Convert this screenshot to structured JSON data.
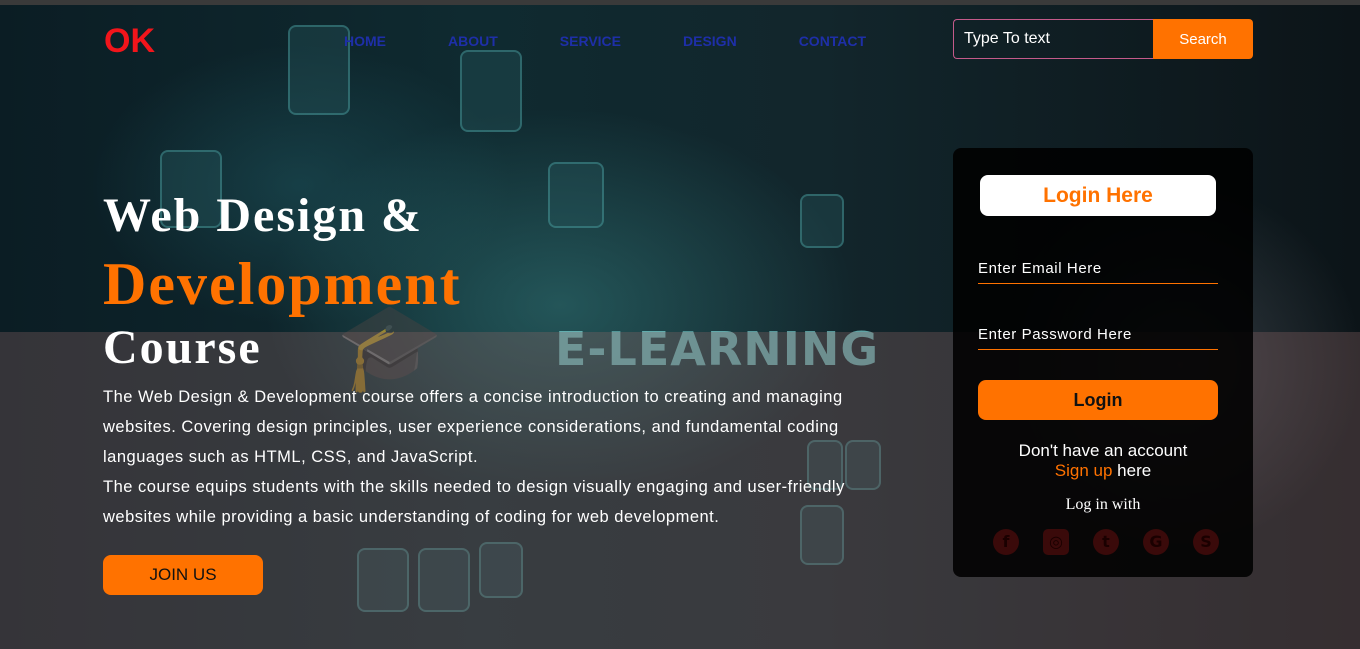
{
  "brand": {
    "logo": "OK",
    "logo_color": "#f2151b"
  },
  "nav": {
    "items": [
      "HOME",
      "ABOUT",
      "SERVICE",
      "DESIGN",
      "CONTACT"
    ],
    "color": "#1e2fa8"
  },
  "search": {
    "placeholder": "Type To text",
    "button_label": "Search"
  },
  "hero": {
    "title_line1": "Web Design &",
    "title_line2": "Development",
    "title_line3": "Course",
    "description_p1": "The Web Design & Development course offers a concise introduction to creating and managing websites. Covering design principles, user experience considerations, and fundamental coding languages such as HTML, CSS, and JavaScript.",
    "description_p2": "The course equips students with the skills needed to design visually engaging and user-friendly websites while providing a basic understanding of coding for web development.",
    "join_label": "JOIN US"
  },
  "background": {
    "overlay_text": "E-LEARNING"
  },
  "login": {
    "heading": "Login Here",
    "email_placeholder": "Enter Email Here",
    "password_placeholder": "Enter Password Here",
    "button_label": "Login",
    "no_account": "Don't have an account",
    "signup_link": "Sign up",
    "signup_suffix": " here",
    "login_with": "Log in with",
    "socials": [
      "facebook-icon",
      "instagram-icon",
      "twitter-icon",
      "google-icon",
      "skype-icon"
    ]
  },
  "colors": {
    "accent": "#ff7200",
    "card_bg": "#000000"
  }
}
